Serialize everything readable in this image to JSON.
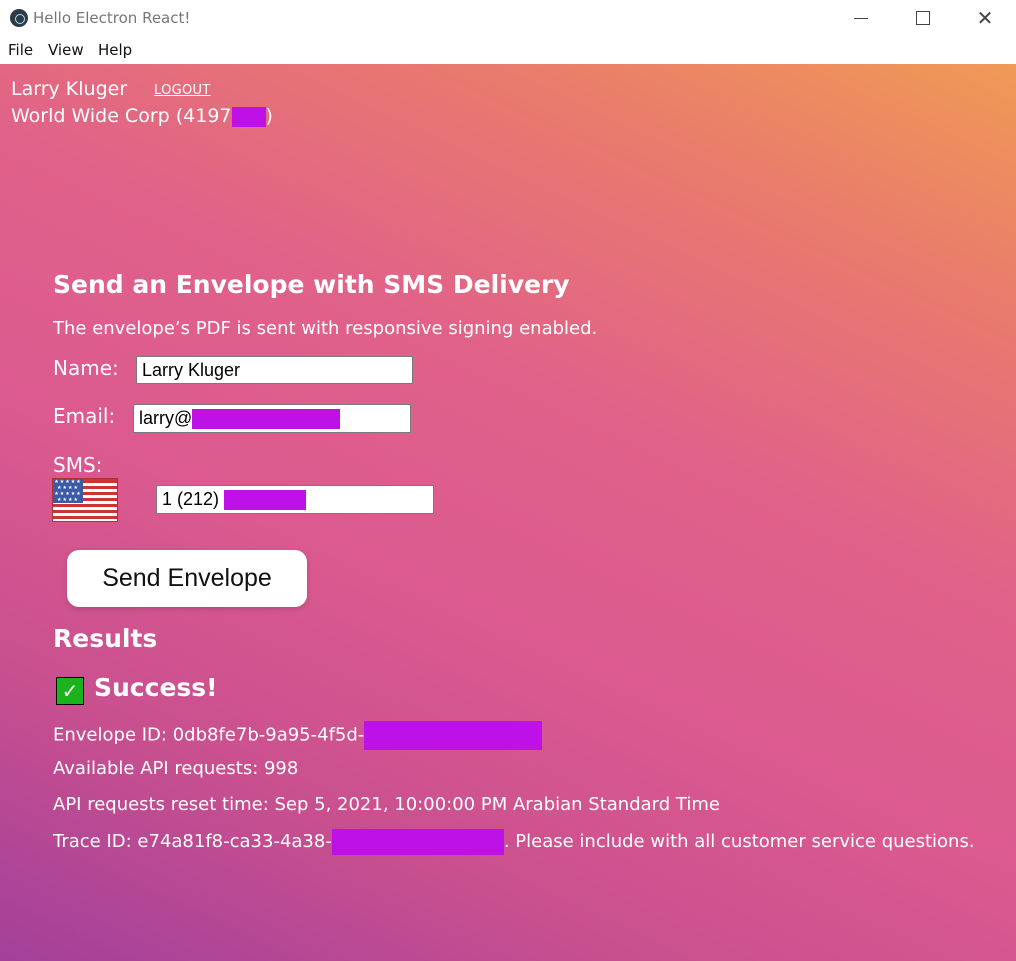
{
  "window": {
    "title": "Hello Electron React!",
    "menu": [
      "File",
      "View",
      "Help"
    ]
  },
  "header": {
    "user_name": "Larry Kluger",
    "logout_label": "LOGOUT",
    "org_prefix": "World Wide Corp (4197",
    "org_suffix": ")"
  },
  "form": {
    "heading": "Send an Envelope with SMS Delivery",
    "subtitle": "The envelope’s PDF is sent with responsive signing enabled.",
    "name_label": "Name:",
    "name_value": "Larry Kluger",
    "email_label": "Email:",
    "email_value": "larry@",
    "sms_label": "SMS:",
    "sms_value": "1 (212) ",
    "country_flag": "us-flag-icon",
    "send_button": "Send Envelope"
  },
  "results": {
    "heading": "Results",
    "status": "Success!",
    "envelope_id": "Envelope ID: 0db8fe7b-9a95-4f5d-",
    "available_requests": "Available API requests: 998",
    "reset_time": "API requests reset time: Sep 5, 2021, 10:00:00 PM Arabian Standard Time",
    "trace_prefix": "Trace ID: e74a81f8-ca33-4a38-",
    "trace_suffix": ". Please include with all customer service questions."
  },
  "colors": {
    "redaction": "#bd11e8",
    "gradient_top": "#f09a55",
    "gradient_mid": "#dc5a8f",
    "gradient_bottom": "#a3409a",
    "success_green": "#1bb31b"
  }
}
